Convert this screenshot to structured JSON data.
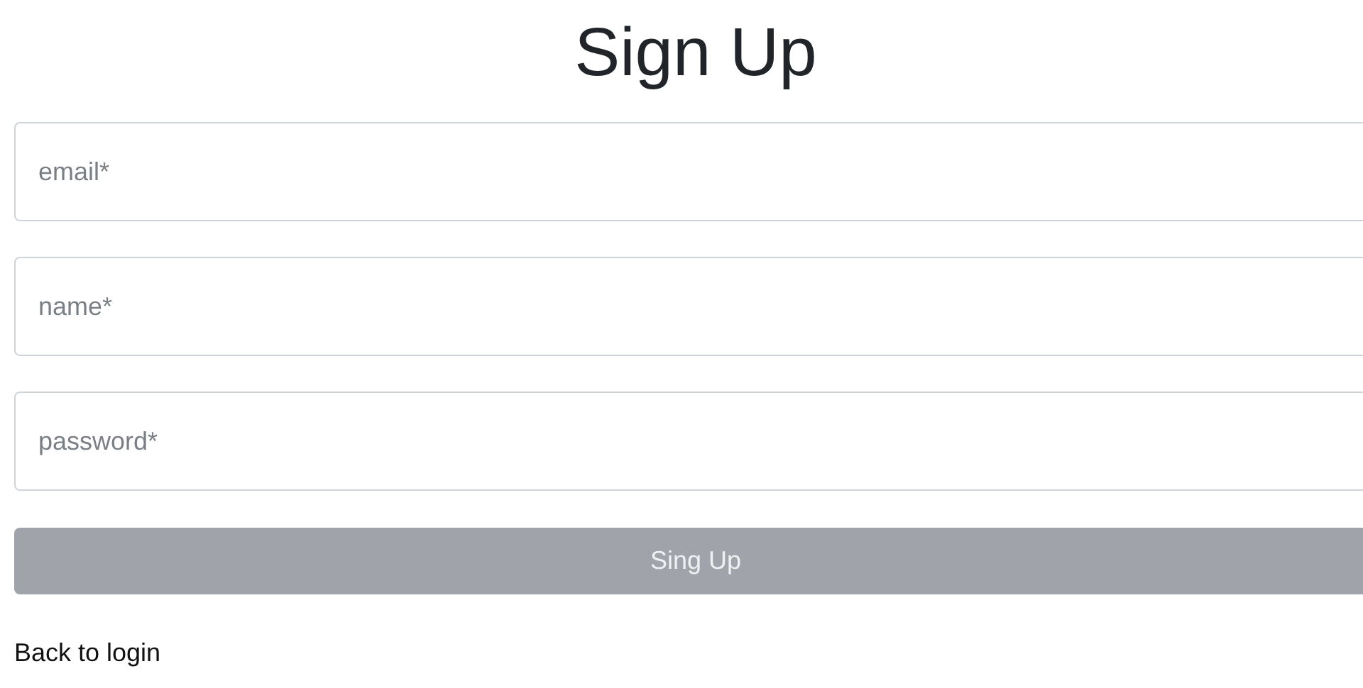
{
  "title": "Sign Up",
  "fields": [
    {
      "placeholder": "email*"
    },
    {
      "placeholder": "name*"
    },
    {
      "placeholder": "password*"
    }
  ],
  "submit_button": {
    "label": "Sing Up",
    "disabled": true
  },
  "back_link": "Back to login"
}
